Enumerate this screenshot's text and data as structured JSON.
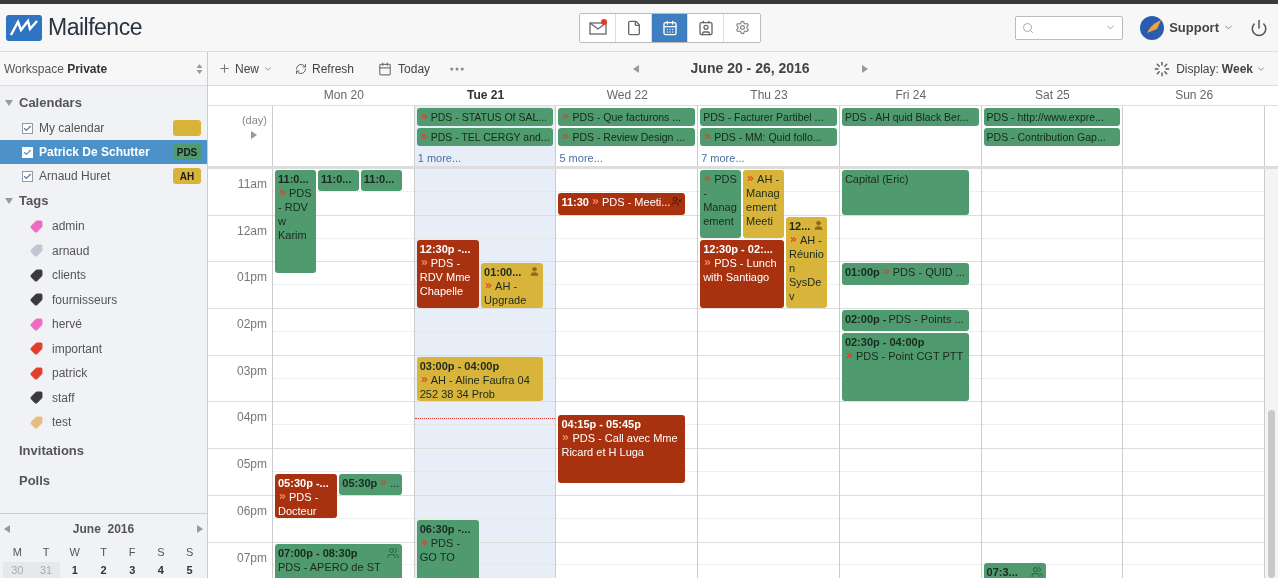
{
  "app": {
    "name": "Mailfence"
  },
  "nav": [
    {
      "kind": "mail",
      "selected": false,
      "badge": true
    },
    {
      "kind": "documents",
      "selected": false,
      "badge": false
    },
    {
      "kind": "calendar",
      "selected": true,
      "badge": false
    },
    {
      "kind": "contacts",
      "selected": false,
      "badge": false
    },
    {
      "kind": "settings",
      "selected": false,
      "badge": false
    }
  ],
  "account": {
    "label": "Support"
  },
  "workspace": {
    "label": "Workspace",
    "value": "Private"
  },
  "sidebar": {
    "calendars_heading": "Calendars",
    "calendars": [
      {
        "label": "My calendar",
        "checked": true,
        "selected": false,
        "color": "#d9b43a"
      },
      {
        "label": "Patrick De Schutter",
        "checked": true,
        "selected": true,
        "badge": "PDS",
        "color": "#4f9a6e"
      },
      {
        "label": "Arnaud Huret",
        "checked": true,
        "selected": false,
        "badge": "AH",
        "color": "#d9b43a"
      }
    ],
    "tags_heading": "Tags",
    "tags": [
      {
        "label": "admin",
        "color": "#ee6bc4"
      },
      {
        "label": "arnaud",
        "color": "#c2c6d2"
      },
      {
        "label": "clients",
        "color": "#3a3a3a"
      },
      {
        "label": "fournisseurs",
        "color": "#3a3a3a"
      },
      {
        "label": "hervé",
        "color": "#ee6bc4"
      },
      {
        "label": "important",
        "color": "#e0402a"
      },
      {
        "label": "patrick",
        "color": "#e0402a"
      },
      {
        "label": "staff",
        "color": "#3a3a3a"
      },
      {
        "label": "test",
        "color": "#e8bb82"
      }
    ],
    "links": [
      "Invitations",
      "Polls"
    ]
  },
  "mini_calendar": {
    "title": "June  2016",
    "weekdays": [
      "M",
      "T",
      "W",
      "T",
      "F",
      "S",
      "S"
    ],
    "days": [
      {
        "label": "30",
        "other_month": true
      },
      {
        "label": "31",
        "other_month": true
      },
      {
        "label": "1",
        "other_month": false
      },
      {
        "label": "2",
        "other_month": false
      },
      {
        "label": "3",
        "other_month": false
      },
      {
        "label": "4",
        "other_month": false
      },
      {
        "label": "5",
        "other_month": false
      }
    ]
  },
  "toolbar": {
    "new": "New",
    "refresh": "Refresh",
    "today": "Today",
    "range": "June 20 - 26, 2016",
    "display_label": "Display:",
    "display_value": "Week"
  },
  "allday_label": "(day)",
  "hours": [
    "11am",
    "12am",
    "01pm",
    "02pm",
    "03pm",
    "04pm",
    "05pm",
    "06pm",
    "07pm"
  ],
  "days": [
    {
      "label": "Mon 20",
      "today": false,
      "events": [
        {
          "time": "11:0...",
          "title": "PDS - RDV w Karim",
          "recurring": true,
          "color": "#4f9a6e",
          "kind": "stacked"
        },
        {
          "time": "11:0...",
          "recurring": false,
          "color": "#4f9a6e",
          "kind": "stacked"
        },
        {
          "time": "11:0...",
          "recurring": false,
          "color": "#4f9a6e",
          "kind": "stacked"
        },
        {
          "time": "05:30p -...",
          "title": "PDS - Docteur",
          "recurring": true,
          "color": "#a8320f",
          "kind": "stacked"
        },
        {
          "time": "05:30p",
          "title": "...",
          "recurring": true,
          "color": "#4f9a6e",
          "kind": "inline"
        },
        {
          "time": "07:00p - 08:30p",
          "title": "PDS - APERO de ST",
          "recurring": false,
          "color": "#4f9a6e",
          "kind": "stacked"
        }
      ]
    },
    {
      "label": "Tue 21",
      "today": true,
      "allday": [
        {
          "title": "PDS - STATUS Of SAL...",
          "recurring": true
        },
        {
          "title": "PDS - TEL CERGY and...",
          "recurring": true
        }
      ],
      "more": "1 more...",
      "events": [
        {
          "time": "12:30p -...",
          "title": "PDS - RDV Mme Chapelle",
          "recurring": true,
          "color": "#a8320f",
          "kind": "stacked"
        },
        {
          "time": "01:00...",
          "title": "AH - Upgrade",
          "recurring": true,
          "color": "#d9b43a",
          "kind": "stacked"
        },
        {
          "time": "03:00p - 04:00p",
          "title": "AH - Aline Faufra 04 252 38 34 Prob",
          "recurring": true,
          "color": "#d9b43a",
          "kind": "stacked"
        },
        {
          "time": "06:30p -...",
          "title": "PDS - GO TO",
          "recurring": true,
          "color": "#4f9a6e",
          "kind": "stacked"
        }
      ]
    },
    {
      "label": "Wed 22",
      "today": false,
      "allday": [
        {
          "title": "PDS - Que facturons ...",
          "recurring": true
        },
        {
          "title": "PDS - Review Design ...",
          "recurring": true
        }
      ],
      "more": "5 more...",
      "events": [
        {
          "time": "11:30",
          "title": "PDS - Meeti...",
          "recurring": true,
          "color": "#a8320f",
          "kind": "inline"
        },
        {
          "time": "04:15p - 05:45p",
          "title": "PDS - Call avec Mme Ricard et H Luga",
          "recurring": true,
          "color": "#a8320f",
          "kind": "stacked"
        }
      ]
    },
    {
      "label": "Thu 23",
      "today": false,
      "allday": [
        {
          "title": "PDS - Facturer Partibel ...",
          "recurring": false
        },
        {
          "title": "PDS - MM: Quid follo...",
          "recurring": true
        }
      ],
      "more": "7 more...",
      "events": [
        {
          "title": "PDS - Management",
          "recurring": true,
          "color": "#4f9a6e",
          "kind": "stacked"
        },
        {
          "title": "AH - Management Meeti",
          "recurring": true,
          "color": "#d9b43a",
          "kind": "stacked"
        },
        {
          "time": "12:30p - 02:...",
          "title": "PDS - Lunch with Santiago",
          "recurring": true,
          "color": "#a8320f",
          "kind": "stacked"
        },
        {
          "time": "12...",
          "title": "AH - Réunion SysDev",
          "recurring": true,
          "color": "#d9b43a",
          "kind": "stacked"
        }
      ]
    },
    {
      "label": "Fri 24",
      "today": false,
      "allday": [
        {
          "title": "PDS - AH quid Black Ber...",
          "recurring": false
        }
      ],
      "events": [
        {
          "title": "Capital (Eric)",
          "recurring": false,
          "color": "#4f9a6e",
          "kind": "stacked"
        },
        {
          "time": "01:00p",
          "title": "PDS - QUID ...",
          "recurring": true,
          "color": "#4f9a6e",
          "kind": "inline"
        },
        {
          "time": "02:00p -",
          "title": "PDS - Points ...",
          "recurring": false,
          "color": "#4f9a6e",
          "kind": "inline"
        },
        {
          "time": "02:30p - 04:00p",
          "title": "PDS - Point CGT PTT",
          "recurring": true,
          "color": "#4f9a6e",
          "kind": "stacked"
        }
      ]
    },
    {
      "label": "Sat 25",
      "today": false,
      "allday": [
        {
          "title": "PDS - http://www.expre...",
          "recurring": false
        },
        {
          "title": "PDS - Contribution Gap...",
          "recurring": false
        }
      ],
      "events": [
        {
          "time": "07:3...",
          "recurring": false,
          "color": "#4f9a6e",
          "kind": "stacked"
        }
      ]
    },
    {
      "label": "Sun 26",
      "today": false
    }
  ]
}
